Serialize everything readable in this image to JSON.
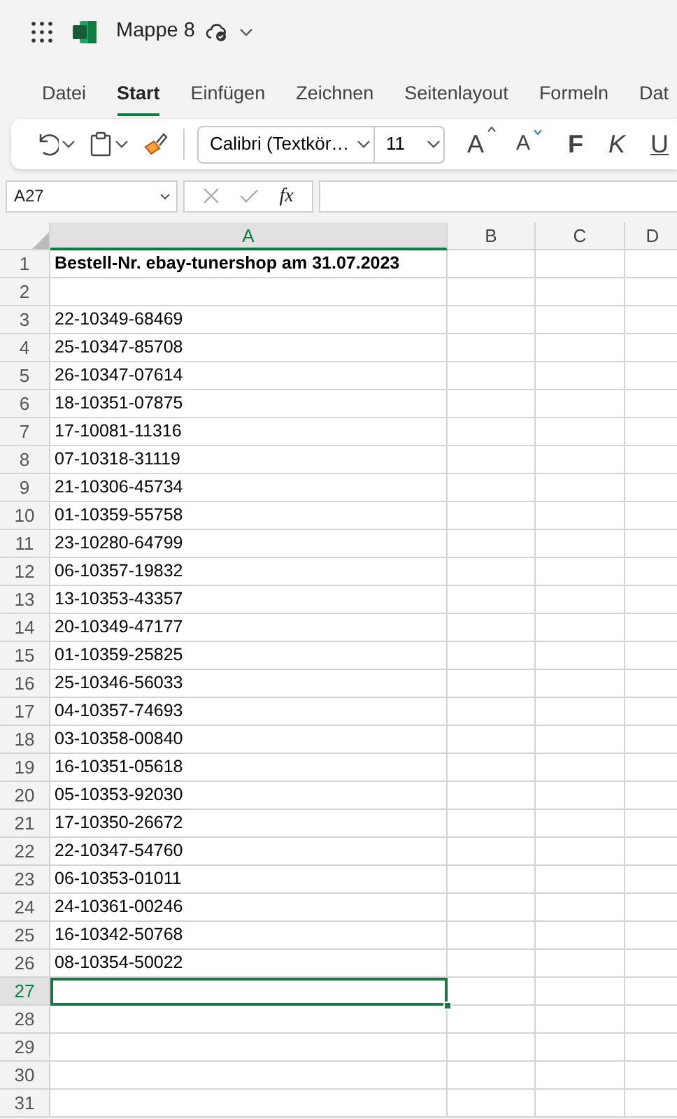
{
  "app": {
    "title": "Mappe 8"
  },
  "tabs": [
    {
      "label": "Datei",
      "selected": false
    },
    {
      "label": "Start",
      "selected": true
    },
    {
      "label": "Einfügen",
      "selected": false
    },
    {
      "label": "Zeichnen",
      "selected": false
    },
    {
      "label": "Seitenlayout",
      "selected": false
    },
    {
      "label": "Formeln",
      "selected": false
    },
    {
      "label": "Dat",
      "selected": false
    }
  ],
  "toolbar": {
    "font": "Calibri (Textkör…",
    "size": "11",
    "grow": "A",
    "shrink": "A",
    "bold": "F",
    "italic": "K",
    "underline": "U"
  },
  "formula_bar": {
    "name_box": "A27",
    "function_label": "fx"
  },
  "columns": [
    {
      "label": "A",
      "selected": true
    },
    {
      "label": "B",
      "selected": false
    },
    {
      "label": "C",
      "selected": false
    },
    {
      "label": "D",
      "selected": false
    }
  ],
  "rows": [
    {
      "number": "1",
      "a": "Bestell-Nr. ebay-tunershop am 31.07.2023",
      "kind": "heading",
      "selected": false
    },
    {
      "number": "2",
      "selected": false
    },
    {
      "number": "3",
      "a": "22-10349-68469",
      "kind": "value",
      "selected": false
    },
    {
      "number": "4",
      "a": "25-10347-85708",
      "kind": "value",
      "selected": false
    },
    {
      "number": "5",
      "a": "26-10347-07614",
      "kind": "value",
      "selected": false
    },
    {
      "number": "6",
      "a": "18-10351-07875",
      "kind": "value",
      "selected": false
    },
    {
      "number": "7",
      "a": "17-10081-11316",
      "kind": "value",
      "selected": false
    },
    {
      "number": "8",
      "a": "07-10318-31119",
      "kind": "value",
      "selected": false
    },
    {
      "number": "9",
      "a": "21-10306-45734",
      "kind": "value",
      "selected": false
    },
    {
      "number": "10",
      "a": "01-10359-55758",
      "kind": "value",
      "selected": false
    },
    {
      "number": "11",
      "a": "23-10280-64799",
      "kind": "value",
      "selected": false
    },
    {
      "number": "12",
      "a": "06-10357-19832",
      "kind": "value",
      "selected": false
    },
    {
      "number": "13",
      "a": "13-10353-43357",
      "kind": "value",
      "selected": false
    },
    {
      "number": "14",
      "a": "20-10349-47177",
      "kind": "value",
      "selected": false
    },
    {
      "number": "15",
      "a": "01-10359-25825",
      "kind": "value",
      "selected": false
    },
    {
      "number": "16",
      "a": "25-10346-56033",
      "kind": "value",
      "selected": false
    },
    {
      "number": "17",
      "a": "04-10357-74693",
      "kind": "value",
      "selected": false
    },
    {
      "number": "18",
      "a": "03-10358-00840",
      "kind": "value",
      "selected": false
    },
    {
      "number": "19",
      "a": "16-10351-05618",
      "kind": "value",
      "selected": false
    },
    {
      "number": "20",
      "a": "05-10353-92030",
      "kind": "value",
      "selected": false
    },
    {
      "number": "21",
      "a": "17-10350-26672",
      "kind": "value",
      "selected": false
    },
    {
      "number": "22",
      "a": "22-10347-54760",
      "kind": "value",
      "selected": false
    },
    {
      "number": "23",
      "a": "06-10353-01011",
      "kind": "value",
      "selected": false
    },
    {
      "number": "24",
      "a": "24-10361-00246",
      "kind": "value",
      "selected": false
    },
    {
      "number": "25",
      "a": "16-10342-50768",
      "kind": "value",
      "selected": false
    },
    {
      "number": "26",
      "a": "08-10354-50022",
      "kind": "value",
      "selected": false
    },
    {
      "number": "27",
      "selected": true
    },
    {
      "number": "28",
      "selected": false
    },
    {
      "number": "29",
      "selected": false
    },
    {
      "number": "30",
      "selected": false
    },
    {
      "number": "31",
      "selected": false
    }
  ]
}
